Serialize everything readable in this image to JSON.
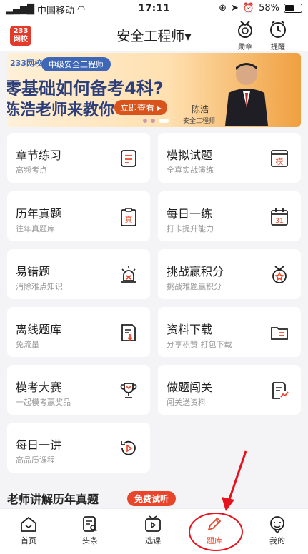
{
  "status": {
    "carrier": "中国移动",
    "time": "17:11",
    "battery": "58%",
    "battery_level": 0.58
  },
  "header": {
    "logo_line1": "233",
    "logo_line2": "网校",
    "title": "安全工程师▾",
    "medal_label": "勋章",
    "remind_label": "提醒"
  },
  "banner": {
    "brand": "233网校",
    "tag": "中级安全工程师",
    "line1": "零基础如何备考4科?",
    "line2": "陈浩老师来教你",
    "button": "立即查看 ▸",
    "name": "陈浩",
    "sub": "安全工程师"
  },
  "cards": [
    {
      "title": "章节练习",
      "sub": "高频考点",
      "icon": "list-doc-icon"
    },
    {
      "title": "模拟试题",
      "sub": "全真实战演练",
      "icon": "mock-exam-icon",
      "glyph": "模"
    },
    {
      "title": "历年真题",
      "sub": "往年真题库",
      "icon": "clipboard-icon",
      "glyph": "真"
    },
    {
      "title": "每日一练",
      "sub": "打卡提升能力",
      "icon": "calendar-icon",
      "glyph": "31"
    },
    {
      "title": "易错题",
      "sub": "消除难点知识",
      "icon": "alarm-light-icon"
    },
    {
      "title": "挑战赢积分",
      "sub": "挑战难题赢积分",
      "icon": "medal-star-icon"
    },
    {
      "title": "离线题库",
      "sub": "免流量",
      "icon": "offline-doc-icon"
    },
    {
      "title": "资料下载",
      "sub": "分享积赞 打包下载",
      "icon": "folder-icon"
    },
    {
      "title": "模考大赛",
      "sub": "一起模考赢奖品",
      "icon": "trophy-icon"
    },
    {
      "title": "做题闯关",
      "sub": "闯关送资料",
      "icon": "level-doc-icon"
    },
    {
      "title": "每日一讲",
      "sub": "高品质课程",
      "icon": "replay-icon"
    }
  ],
  "section": {
    "title": "老师讲解历年真题",
    "badge": "免费试听"
  },
  "tabs": [
    {
      "label": "首页",
      "icon": "home-icon"
    },
    {
      "label": "头条",
      "icon": "news-icon"
    },
    {
      "label": "选课",
      "icon": "course-icon"
    },
    {
      "label": "题库",
      "icon": "pencil-icon",
      "active": true
    },
    {
      "label": "我的",
      "icon": "profile-icon"
    }
  ],
  "colors": {
    "accent": "#e8452a",
    "annotation": "#e8121c",
    "banner_text": "#2c3f7a"
  }
}
